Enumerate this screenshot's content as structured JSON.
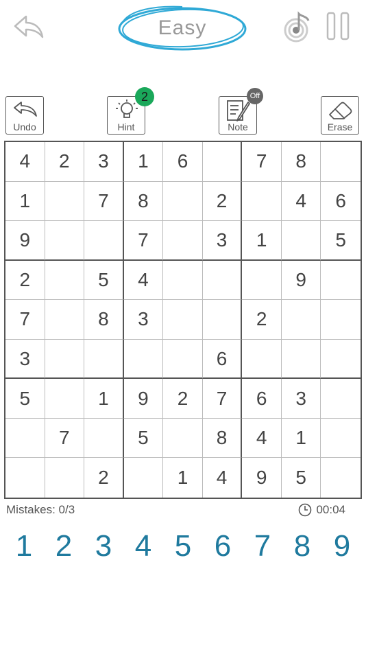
{
  "header": {
    "difficulty": "Easy",
    "circle_color": "#2fa9d6"
  },
  "toolbar": {
    "undo_label": "Undo",
    "hint_label": "Hint",
    "hint_count": "2",
    "note_label": "Note",
    "note_state": "Off",
    "erase_label": "Erase",
    "badge_green": "#1aa85a"
  },
  "board": [
    [
      "4",
      "2",
      "3",
      "1",
      "6",
      "",
      "7",
      "8",
      ""
    ],
    [
      "1",
      "",
      "7",
      "8",
      "",
      "2",
      "",
      "4",
      "6"
    ],
    [
      "9",
      "",
      "",
      "7",
      "",
      "3",
      "1",
      "",
      "5"
    ],
    [
      "2",
      "",
      "5",
      "4",
      "",
      "",
      "",
      "9",
      ""
    ],
    [
      "7",
      "",
      "8",
      "3",
      "",
      "",
      "2",
      "",
      ""
    ],
    [
      "3",
      "",
      "",
      "",
      "",
      "6",
      "",
      "",
      ""
    ],
    [
      "5",
      "",
      "1",
      "9",
      "2",
      "7",
      "6",
      "3",
      ""
    ],
    [
      "",
      "7",
      "",
      "5",
      "",
      "8",
      "4",
      "1",
      ""
    ],
    [
      "",
      "",
      "2",
      "",
      "1",
      "4",
      "9",
      "5",
      ""
    ]
  ],
  "status": {
    "mistakes": "Mistakes: 0/3",
    "timer": "00:04"
  },
  "numpad": [
    "1",
    "2",
    "3",
    "4",
    "5",
    "6",
    "7",
    "8",
    "9"
  ],
  "numpad_color": "#1f7a9e"
}
